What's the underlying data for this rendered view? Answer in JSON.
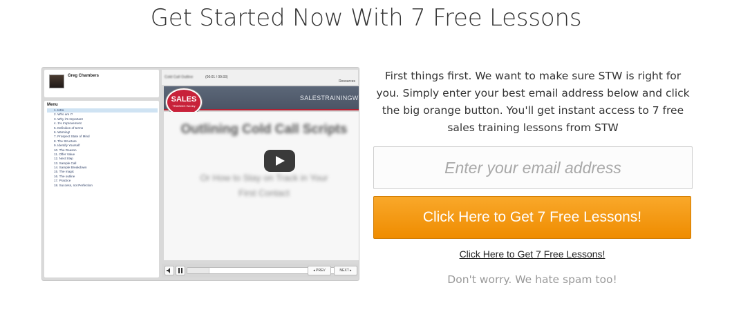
{
  "headline": "Get Started Now With 7 Free Lessons",
  "video_mock": {
    "profile_name": "Greg Chambers",
    "menu_title": "Menu",
    "menu_items": [
      "1. Intro",
      "2. Who am I?",
      "3. Why it's Important",
      "4. 1% Improvement",
      "5. Definition of terms",
      "6. Warning!",
      "7. Prospect State of Mind",
      "8. The Structure",
      "9. Identify Yourself",
      "10. The Reason",
      "11. Offer Value",
      "12. Next Step",
      "13. Sample Call",
      "14. Sample Breakdown",
      "15. The magic",
      "16. The outline",
      "17. Practice",
      "18. Success, not Perfection"
    ],
    "lesson_title": "Cold Call Outline",
    "time": "(00:01 / 09:33)",
    "resources_label": "Resources",
    "logo_text": "SALES",
    "logo_subtext": "TRAINING Weekly",
    "banner_brand": "SALESTRAININGWEEKLY.COM",
    "slide_heading": "Outlining Cold Call Scripts",
    "slide_sub": "Or How to Stay on Track in Your First Contact",
    "prev_label": "◂ PREV",
    "next_label": "NEXT ▸",
    "progress": 0.15
  },
  "intro_text": "First things first. We want to make sure STW is right for you. Simply enter your best email address below and click the big orange button. You'll get instant access to 7 free sales training lessons from STW",
  "email": {
    "placeholder": "Enter your email address",
    "value": ""
  },
  "cta_button_label": "Click Here to Get 7 Free Lessons!",
  "cta_link_label": "Click Here to Get 7 Free Lessons!",
  "spam_note": "Don't worry. We hate spam too!",
  "colors": {
    "accent": "#f39a12",
    "banner": "#555f70",
    "brand_red": "#c8223a"
  }
}
